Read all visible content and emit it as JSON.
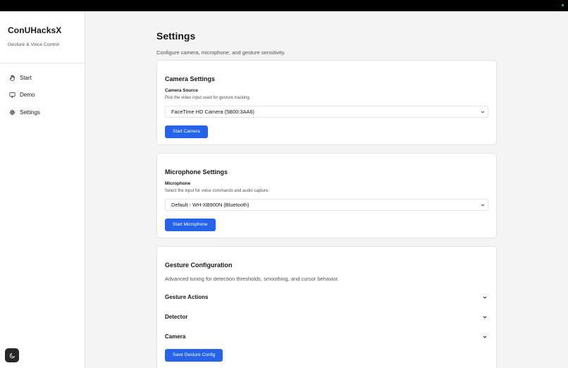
{
  "sidebar": {
    "brand_title": "ConUHacksX",
    "brand_subtitle": "Gesture & Voice Control",
    "items": [
      {
        "label": "Start",
        "icon": "hand-icon"
      },
      {
        "label": "Demo",
        "icon": "monitor-icon"
      },
      {
        "label": "Settings",
        "icon": "gear-icon"
      }
    ],
    "theme_toggle_icon": "moon-icon"
  },
  "page": {
    "title": "Settings",
    "subtitle": "Configure camera, microphone, and gesture sensitivity."
  },
  "camera": {
    "title": "Camera Settings",
    "label": "Camera Source",
    "hint": "Pick the video input used for gesture tracking.",
    "selected": "FaceTime HD Camera (5B00:3AA6)",
    "button": "Start Camera"
  },
  "microphone": {
    "title": "Microphone Settings",
    "label": "Microphone",
    "hint": "Select the input for voice commands and audio capture.",
    "selected": "Default - WH-XB900N (Bluetooth)",
    "button": "Start Microphone"
  },
  "gesture": {
    "title": "Gesture Configuration",
    "subtitle": "Advanced tuning for detection thresholds, smoothing, and cursor behavior.",
    "sections": [
      "Gesture Actions",
      "Detector",
      "Camera"
    ],
    "button": "Save Gesture Config"
  },
  "colors": {
    "accent": "#2563eb",
    "sidebar_bg": "#ffffff",
    "page_bg": "#f4f4f5"
  }
}
